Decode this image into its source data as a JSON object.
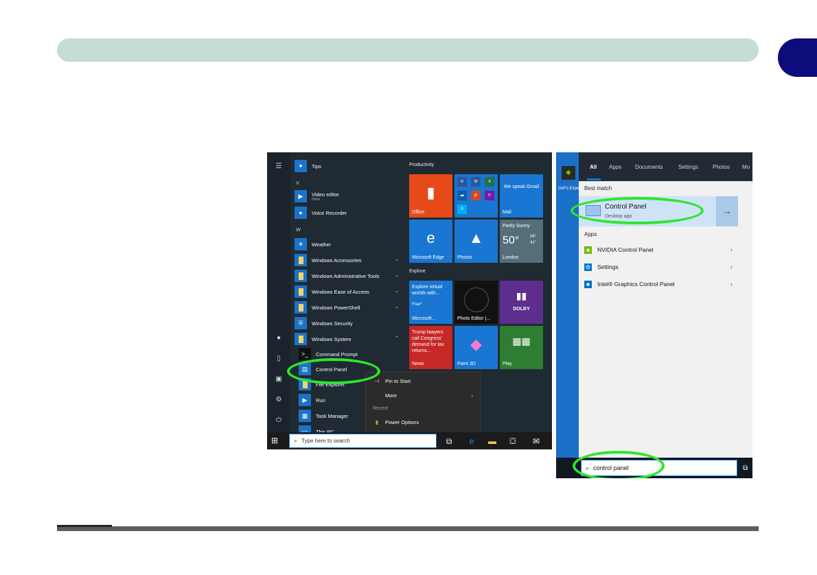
{
  "start_menu": {
    "apps": {
      "tips": "Tips",
      "letter_v": "V",
      "video_editor": "Video editor",
      "video_editor_sub": "New",
      "voice_recorder": "Voice Recorder",
      "letter_w": "W",
      "weather": "Weather",
      "win_accessories": "Windows Accessories",
      "win_admin": "Windows Administrative Tools",
      "win_ease": "Windows Ease of Access",
      "win_powershell": "Windows PowerShell",
      "win_security": "Windows Security",
      "win_system": "Windows System",
      "command_prompt": "Command Prompt",
      "control_panel": "Control Panel",
      "file_explorer": "File Explorer",
      "run": "Run",
      "task_manager": "Task Manager",
      "this_pc": "This PC"
    },
    "sections": {
      "productivity": "Productivity",
      "explore": "Explore"
    },
    "tiles": {
      "office": "Office",
      "mail_text": "We speak Gmail",
      "mail": "Mail",
      "edge": "Microsoft Edge",
      "photos": "Photos",
      "weather_cond": "Partly Sunny",
      "weather_temp": "50°",
      "weather_hi": "56°",
      "weather_lo": "41°",
      "weather_city": "London",
      "store_text": "Explore virtual worlds with...",
      "store_price": "Free*",
      "store": "Microsoft...",
      "photo_editor": "Photo Editor |...",
      "dolby": "DOLBY",
      "news_text": "Trump lawyers call Congress' demand for tax returns...",
      "news": "News",
      "paint3d": "Paint 3D",
      "play": "Play"
    },
    "context_menu": {
      "pin": "Pin to Start",
      "more": "More",
      "recent": "Recent",
      "power": "Power Options"
    },
    "taskbar": {
      "search_placeholder": "Type here to search"
    }
  },
  "search_panel": {
    "tabs": [
      "All",
      "Apps",
      "Documents",
      "Settings",
      "Photos",
      "Mo"
    ],
    "best_match_label": "Best match",
    "best_title": "Control Panel",
    "best_sub": "Desktop app",
    "apps_label": "Apps",
    "results": [
      "NVIDIA Control Panel",
      "Settings",
      "Intel® Graphics Control Panel"
    ],
    "query": "control panel",
    "desktop_icon_label": "GeFo Expe"
  },
  "colors": {
    "highlight_ring": "#2ee62e",
    "chapter_tab": "#0c0c7a",
    "header_bar": "#c5ddd6"
  }
}
